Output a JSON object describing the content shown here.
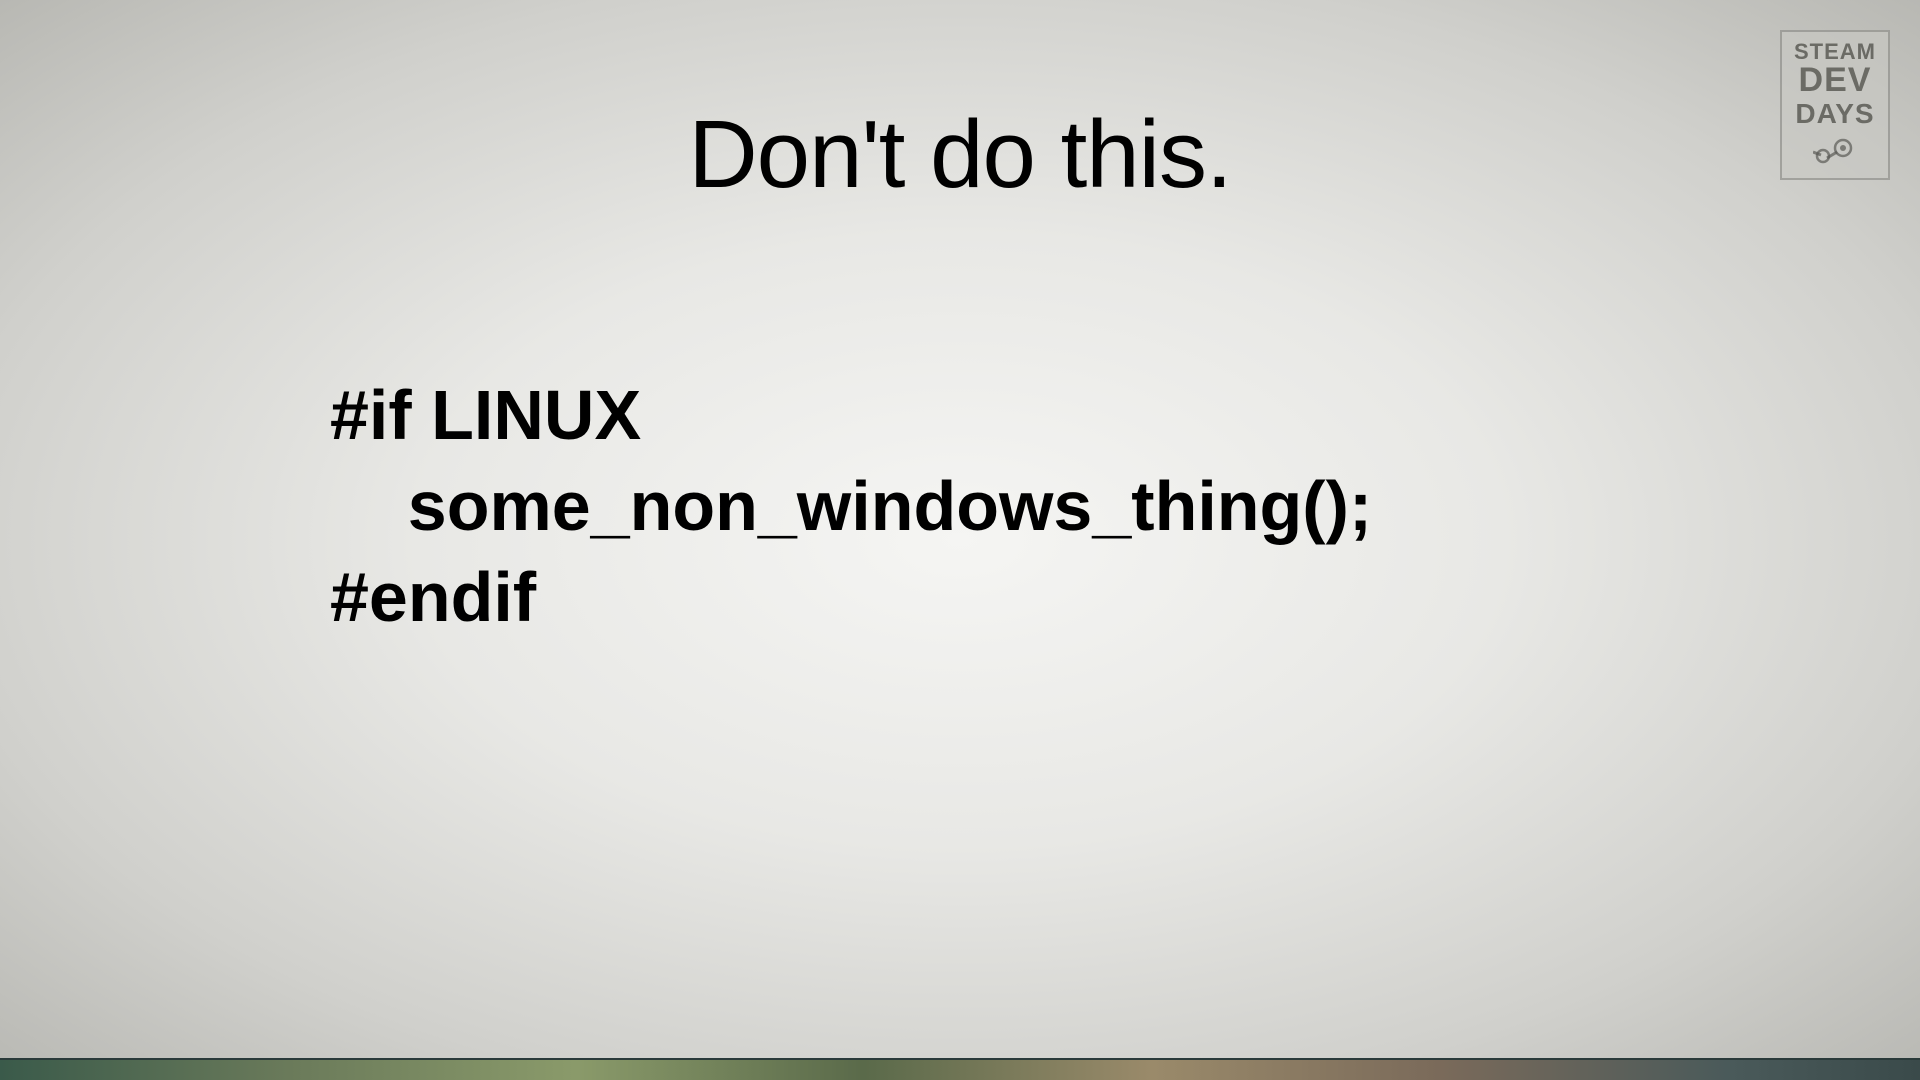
{
  "slide": {
    "title": "Don't do this.",
    "code": {
      "line1": "#if LINUX",
      "line2": "    some_non_windows_thing();",
      "line3": "#endif"
    }
  },
  "logo": {
    "line1": "STEAM",
    "line2": "DEV",
    "line3": "DAYS"
  }
}
